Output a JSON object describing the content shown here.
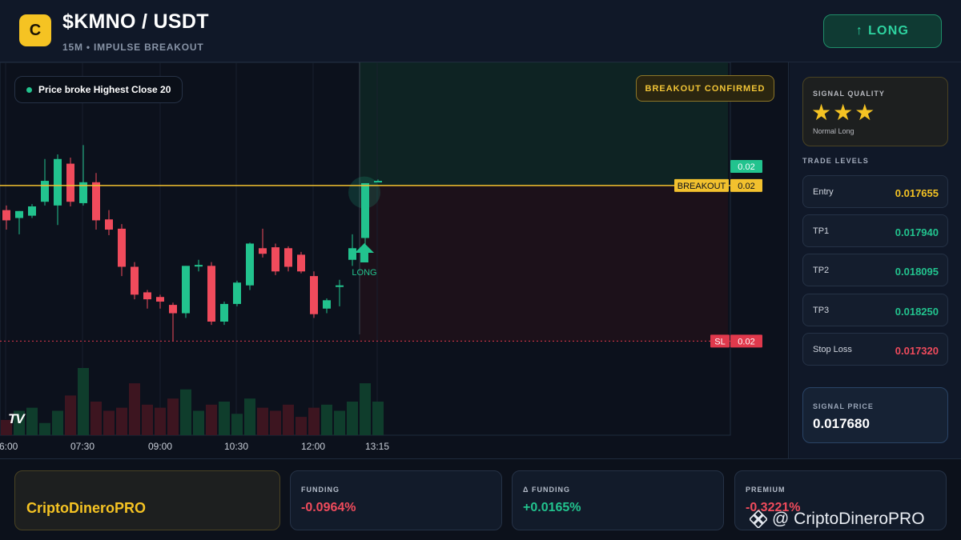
{
  "header": {
    "logo_letter": "C",
    "pair": "$KMNO / USDT",
    "subtitle": "15M • IMPULSE BREAKOUT",
    "long_button": {
      "arrow": "↑",
      "label": "LONG"
    }
  },
  "chart": {
    "pill": "Price broke Highest Close 20",
    "confirmed": "BREAKOUT CONFIRMED",
    "watermark_logo": "TV",
    "time_labels": [
      "6:00",
      "07:30",
      "09:00",
      "10:30",
      "12:00",
      "13:15"
    ],
    "price_tags": {
      "current": "0.02",
      "breakout_label": "BREAKOUT",
      "breakout_value": "0.02",
      "sl_label": "SL",
      "sl_value": "0.02"
    },
    "signal_label": "LONG",
    "colors": {
      "up": "#22c38e",
      "down": "#f04b5c",
      "breakout": "#f2c12e",
      "sl": "#e0394c"
    }
  },
  "chart_data": {
    "type": "candlestick",
    "x": [
      "06:00",
      "07:30",
      "09:00",
      "10:30",
      "12:00",
      "13:15"
    ],
    "candles": [
      {
        "o": 0.017602,
        "h": 0.017612,
        "l": 0.01756,
        "c": 0.01758
      },
      {
        "o": 0.017585,
        "h": 0.0176,
        "l": 0.01755,
        "c": 0.0176
      },
      {
        "o": 0.01759,
        "h": 0.017615,
        "l": 0.017585,
        "c": 0.01761
      },
      {
        "o": 0.01762,
        "h": 0.017712,
        "l": 0.017612,
        "c": 0.017665
      },
      {
        "o": 0.017612,
        "h": 0.017722,
        "l": 0.01757,
        "c": 0.017712
      },
      {
        "o": 0.017702,
        "h": 0.017715,
        "l": 0.01761,
        "c": 0.01762
      },
      {
        "o": 0.017617,
        "h": 0.017742,
        "l": 0.017612,
        "c": 0.017662
      },
      {
        "o": 0.017662,
        "h": 0.017682,
        "l": 0.01756,
        "c": 0.01758
      },
      {
        "o": 0.017582,
        "h": 0.017602,
        "l": 0.017548,
        "c": 0.01756
      },
      {
        "o": 0.017562,
        "h": 0.017572,
        "l": 0.01746,
        "c": 0.01748
      },
      {
        "o": 0.01748,
        "h": 0.01749,
        "l": 0.01741,
        "c": 0.01742
      },
      {
        "o": 0.017425,
        "h": 0.01743,
        "l": 0.01739,
        "c": 0.01741
      },
      {
        "o": 0.017415,
        "h": 0.01742,
        "l": 0.01739,
        "c": 0.017405
      },
      {
        "o": 0.017398,
        "h": 0.017403,
        "l": 0.01732,
        "c": 0.01738
      },
      {
        "o": 0.01738,
        "h": 0.017482,
        "l": 0.01737,
        "c": 0.017482
      },
      {
        "o": 0.017482,
        "h": 0.017495,
        "l": 0.01747,
        "c": 0.017484
      },
      {
        "o": 0.017482,
        "h": 0.01749,
        "l": 0.017355,
        "c": 0.017362
      },
      {
        "o": 0.017362,
        "h": 0.017405,
        "l": 0.017355,
        "c": 0.0174
      },
      {
        "o": 0.0174,
        "h": 0.01745,
        "l": 0.017395,
        "c": 0.017446
      },
      {
        "o": 0.01744,
        "h": 0.017532,
        "l": 0.01743,
        "c": 0.01753
      },
      {
        "o": 0.01752,
        "h": 0.017562,
        "l": 0.0175,
        "c": 0.017508
      },
      {
        "o": 0.017522,
        "h": 0.01753,
        "l": 0.017462,
        "c": 0.01747
      },
      {
        "o": 0.01752,
        "h": 0.017524,
        "l": 0.01747,
        "c": 0.01748
      },
      {
        "o": 0.017506,
        "h": 0.017512,
        "l": 0.017466,
        "c": 0.01747
      },
      {
        "o": 0.01746,
        "h": 0.01747,
        "l": 0.01737,
        "c": 0.017378
      },
      {
        "o": 0.01739,
        "h": 0.017412,
        "l": 0.01738,
        "c": 0.017408
      },
      {
        "o": 0.01744,
        "h": 0.017452,
        "l": 0.017395,
        "c": 0.01744
      },
      {
        "o": 0.017495,
        "h": 0.01755,
        "l": 0.017482,
        "c": 0.01752
      },
      {
        "o": 0.017542,
        "h": 0.01758,
        "l": 0.01752,
        "c": 0.01766
      },
      {
        "o": 0.017665,
        "h": 0.017668,
        "l": 0.017662,
        "c": 0.017665
      }
    ],
    "volumes": [
      5,
      8,
      9,
      4,
      8,
      13,
      22,
      11,
      8,
      9,
      17,
      10,
      9,
      12,
      15,
      8,
      10,
      11,
      7,
      12,
      9,
      8,
      10,
      6,
      9,
      10,
      8,
      11,
      17,
      11
    ],
    "levels": {
      "breakout": 0.017655,
      "stop_loss": 0.01732,
      "tp3_zone": 0.01794
    },
    "ylim": [
      0.0173,
      0.017765
    ],
    "legend": "none",
    "grid": true
  },
  "sidebar": {
    "quality": {
      "label": "SIGNAL QUALITY",
      "stars": "★★★",
      "sub": "Normal Long"
    },
    "levels_title": "TRADE LEVELS",
    "levels": [
      {
        "name": "Entry",
        "value": "0.017655",
        "color": "#f5c323"
      },
      {
        "name": "TP1",
        "value": "0.017940",
        "color": "#22c38e"
      },
      {
        "name": "TP2",
        "value": "0.018095",
        "color": "#22c38e"
      },
      {
        "name": "TP3",
        "value": "0.018250",
        "color": "#22c38e"
      },
      {
        "name": "Stop Loss",
        "value": "0.017320",
        "color": "#f04b5c"
      }
    ],
    "signal_price": {
      "label": "SIGNAL PRICE",
      "value": "0.017680"
    }
  },
  "footer": {
    "brand": "CriptoDineroPRO",
    "stats": [
      {
        "label": "FUNDING",
        "value": "-0.0964%",
        "color": "#f04b5c"
      },
      {
        "label": "Δ FUNDING",
        "value": "+0.0165%",
        "color": "#22c38e"
      },
      {
        "label": "PREMIUM",
        "value": "-0.3221%",
        "color": "#f04b5c"
      }
    ],
    "watermark": "@ CriptoDineroPRO"
  }
}
